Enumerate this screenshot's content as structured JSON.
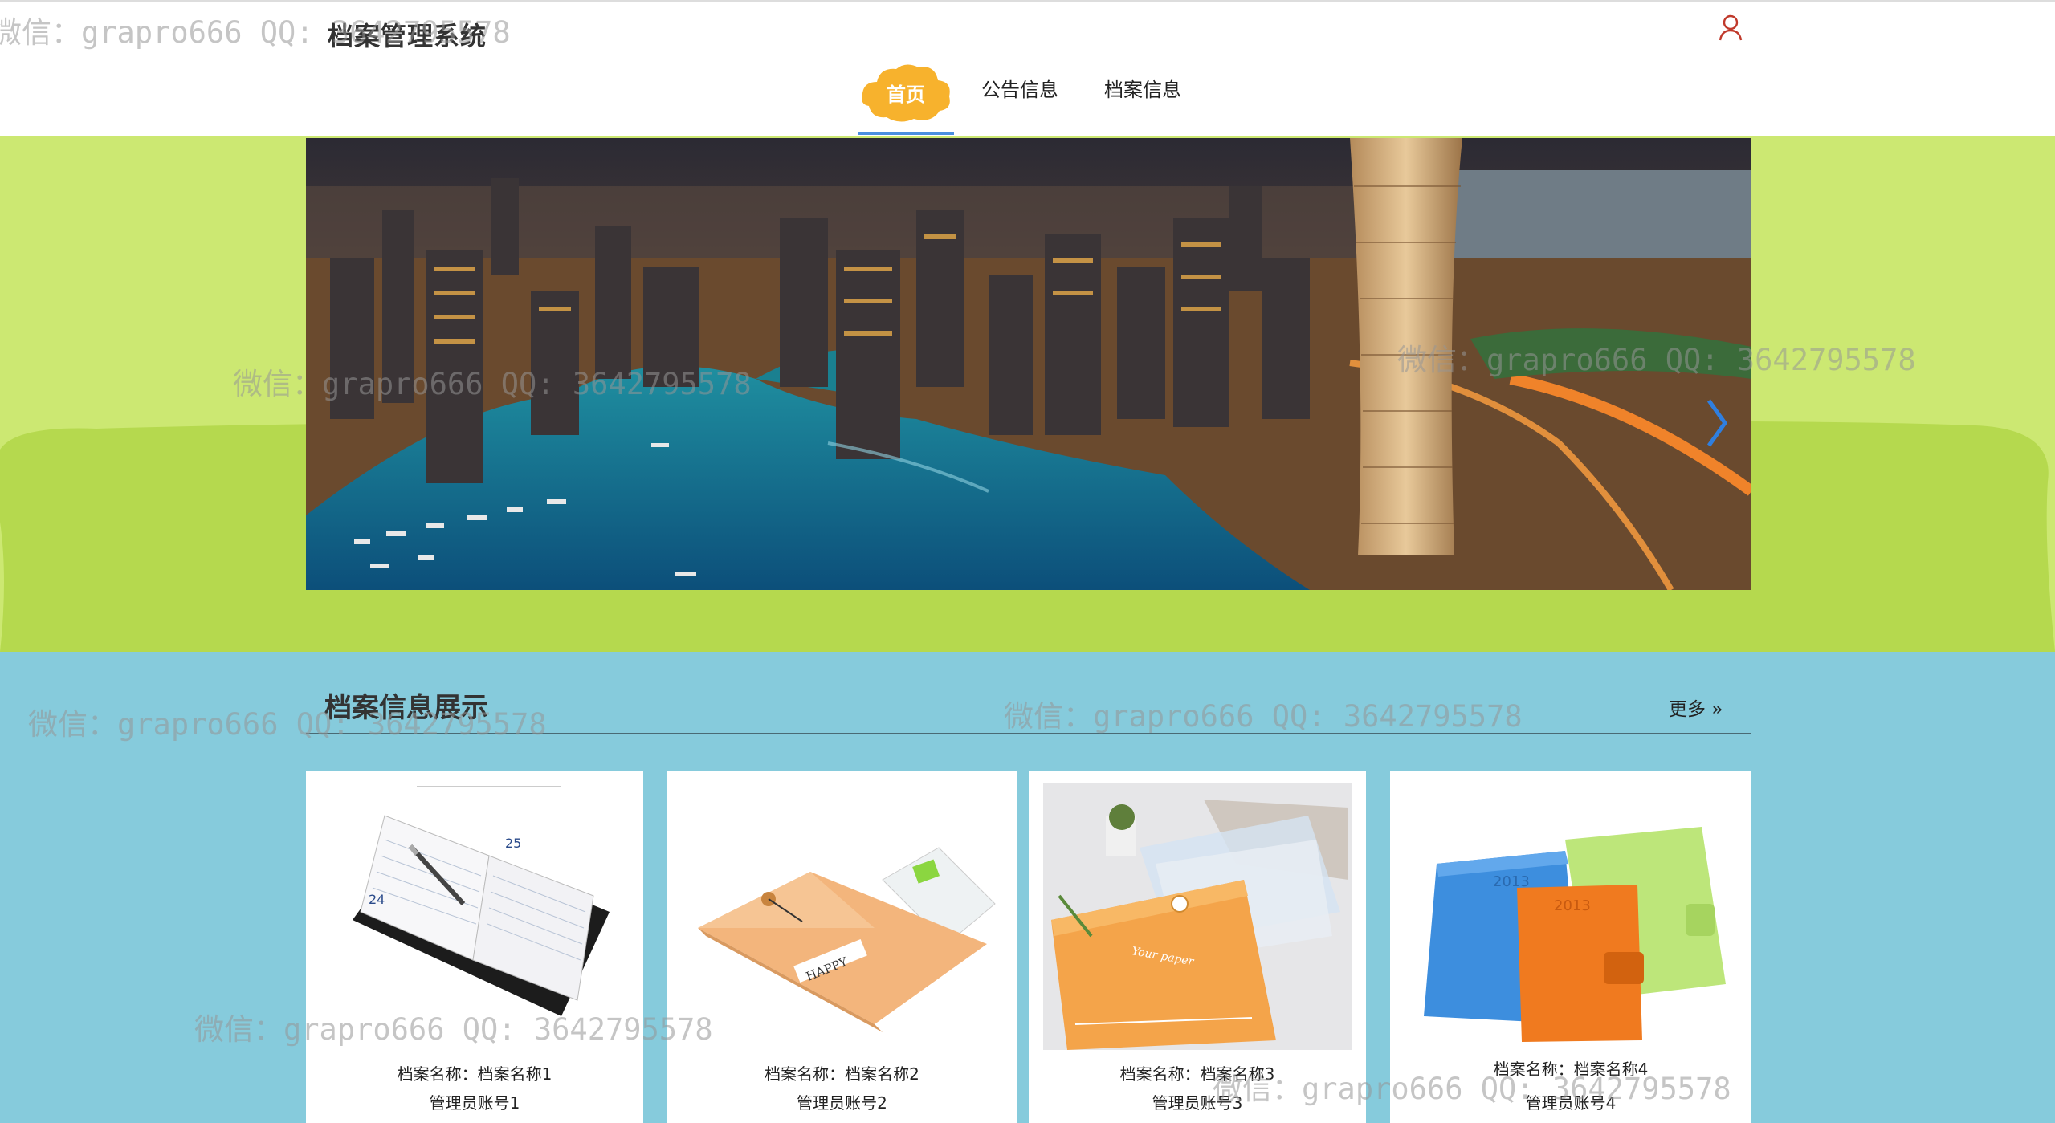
{
  "header": {
    "site_title": "档案管理系统",
    "nav": {
      "home": "首页",
      "notices": "公告信息",
      "archives": "档案信息"
    }
  },
  "section": {
    "title": "档案信息展示",
    "more": "更多",
    "more_icon": "double-chevron-right-icon"
  },
  "cards": [
    {
      "name": "档案名称：档案名称1",
      "account": "管理员账号1",
      "image": "notebook-planner"
    },
    {
      "name": "档案名称：档案名称2",
      "account": "管理员账号2",
      "image": "kraft-envelope"
    },
    {
      "name": "档案名称：档案名称3",
      "account": "管理员账号3",
      "image": "plastic-file-folders"
    },
    {
      "name": "档案名称：档案名称4",
      "account": "管理员账号4",
      "image": "leather-notebooks"
    }
  ],
  "watermarks": {
    "wm1": "微信：grapro666 QQ: 3642795578",
    "wm2": "微信：grapro666 QQ: 3642795578",
    "wm3": "微信：grapro666 QQ: 3642795578",
    "wm4": "微信：grapro666 QQ: 3642795578",
    "wm5": "微信：grapro666 QQ: 3642795578",
    "wm6": "微信：grapro666 QQ: 3642795578",
    "wm7": "微信：grapro666 QQ: 3642795578"
  },
  "colors": {
    "banner_band": "#cce872",
    "band_blob": "#b5d94e",
    "content_bg": "#86cbdc",
    "nav_active": "#f7b22d",
    "nav_underline": "#4a8fe0"
  }
}
